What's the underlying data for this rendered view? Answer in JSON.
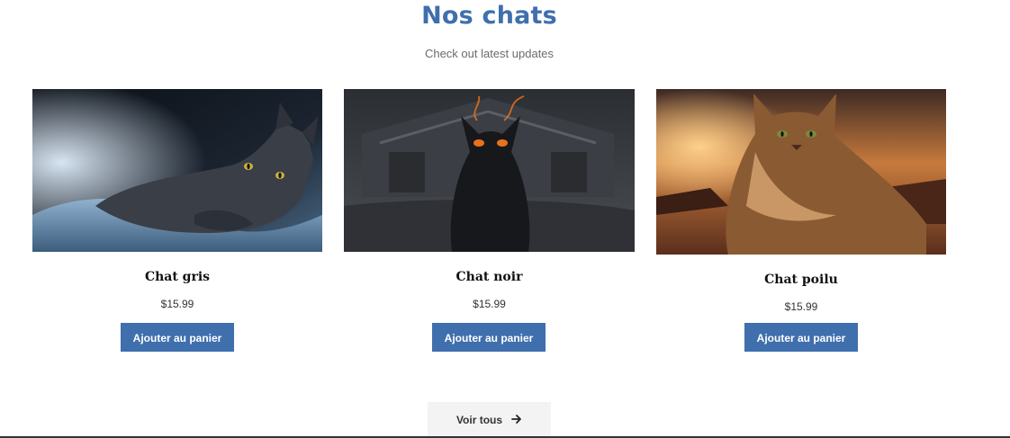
{
  "section": {
    "title": "Nos chats",
    "subtitle": "Check out latest updates"
  },
  "products": [
    {
      "name": "Chat gris",
      "price": "$15.99",
      "cta": "Ajouter au panier"
    },
    {
      "name": "Chat noir",
      "price": "$15.99",
      "cta": "Ajouter au panier"
    },
    {
      "name": "Chat poilu",
      "price": "$15.99",
      "cta": "Ajouter au panier"
    }
  ],
  "see_all": {
    "label": "Voir tous",
    "icon": "arrow-right-icon"
  },
  "colors": {
    "accent": "#3f6fad",
    "button_text": "#ffffff",
    "see_all_bg": "#f3f3f3"
  }
}
